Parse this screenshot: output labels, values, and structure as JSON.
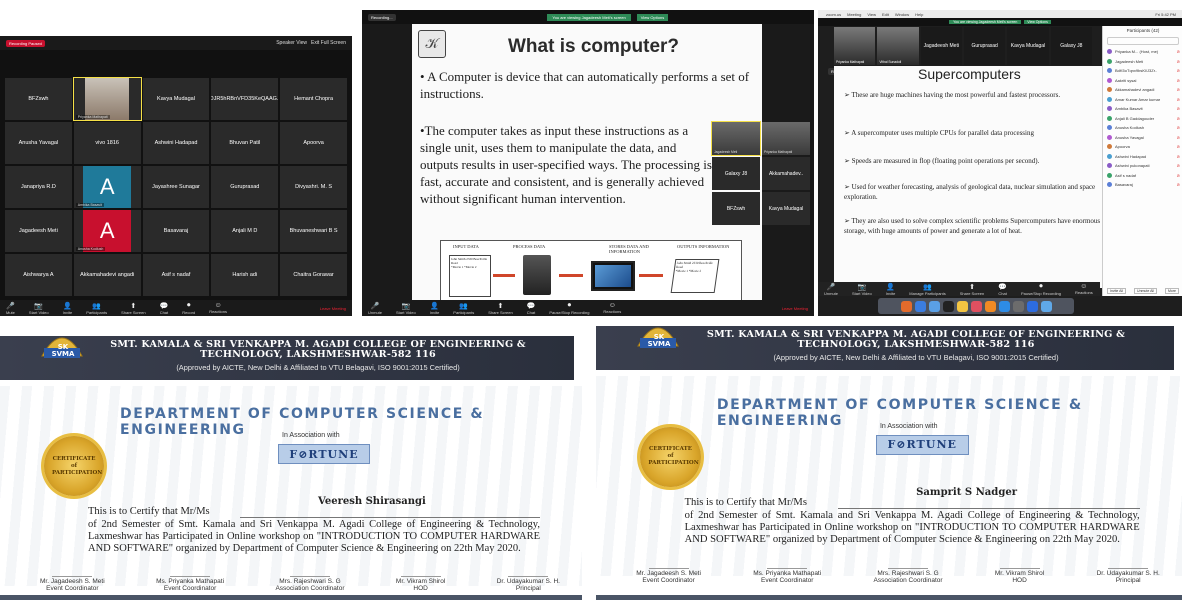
{
  "zoom_gallery": {
    "recording_label": "Recording Paused",
    "top_right": "Speaker View",
    "top_right2": "Exit Full Screen",
    "tiles": [
      {
        "name": "BFZswh"
      },
      {
        "name": "Priyanka Mathapati",
        "photo": true,
        "active": true
      },
      {
        "name": "Kavya Mudagal"
      },
      {
        "name": "DJR5hRBnVFD35KeQAAG.."
      },
      {
        "name": "Hemant Chopra"
      },
      {
        "name": "Anusha Yavagal"
      },
      {
        "name": "vivo 1816"
      },
      {
        "name": "Ashwini Hadapad"
      },
      {
        "name": "Bhuvan Patil"
      },
      {
        "name": "Apoorva"
      },
      {
        "name": "Janapriya R.D"
      },
      {
        "name": "A",
        "avatar": true,
        "color": "#1f7a9a",
        "sub": "Ambika Basavit"
      },
      {
        "name": "Jayashree Sunagar"
      },
      {
        "name": "Guruprasad"
      },
      {
        "name": "Divyashri. M. S"
      },
      {
        "name": "Jagadeesh Meti"
      },
      {
        "name": "A",
        "avatar": true,
        "color": "#c8102e",
        "sub": "Anusha Kodlush"
      },
      {
        "name": "Basavaraj"
      },
      {
        "name": "Anjali M D"
      },
      {
        "name": "Bhuvaneshwari B S"
      },
      {
        "name": "Aishwarya A"
      },
      {
        "name": "Akkamahadevi angadi"
      },
      {
        "name": "Asif s nadaf"
      },
      {
        "name": "Harish adi"
      },
      {
        "name": "Chaitra Gorawar"
      }
    ],
    "toolbar": [
      "Mute",
      "Start Video",
      "Invite",
      "Participants",
      "Share Screen",
      "Chat",
      "Record",
      "Reactions"
    ],
    "leave": "Leave Meeting"
  },
  "zoom_slide": {
    "banner": "You are viewing Jagadeesh Meti's screen",
    "view_options": "View Options",
    "recording_label": "Recording...",
    "title": "What is computer?",
    "bullet1": "• A Computer is device that can automatically performs a set of instructions.",
    "bullet2": "•The computer takes  as input these instructions as a single unit, uses  them to manipulate the data, and outputs results in user-specified ways. The processing is fast, accurate and consistent, and is generally  achieved without significant human intervention.",
    "flow": {
      "input": "INPUT DATA",
      "process": "PROCESS DATA",
      "stores": "STORES DATA AND INFORMATION",
      "outputs": "OUTPUTS INFORMATION",
      "card": "John Smith 2330 Beechville Road",
      "movies": "*Movie 1 *Movie 2"
    },
    "tiles": [
      {
        "name": "Jagadeesh Meti",
        "photo": true,
        "active": true
      },
      {
        "name": "Priyanka Mathapati",
        "photo": true
      },
      {
        "name": "Galaxy J8"
      },
      {
        "name": "Akkamahadev.."
      },
      {
        "name": "BFZswh"
      },
      {
        "name": "Kavya Mudagal"
      }
    ],
    "toolbar": [
      "Unmute",
      "Start Video",
      "Invite",
      "Participants",
      "Share Screen",
      "Chat",
      "Pause/Stop Recording",
      "Reactions"
    ],
    "leave": "Leave Meeting"
  },
  "zoom_super": {
    "menubar": [
      "zoom.us",
      "Meeting",
      "View",
      "Edit",
      "Window",
      "Help"
    ],
    "banner": "You are viewing Jagadeesh Meti's screen",
    "view_options": "View Options",
    "clock": "Fri 5:42 PM",
    "thumbs": [
      {
        "name": "Priyanka Mathapati",
        "photo": true
      },
      {
        "name": "Vithal Sunadoli",
        "photo": true
      },
      {
        "name": "Jagadeesh Meti"
      },
      {
        "name": "Guruprasad"
      },
      {
        "name": "Kavya Mudagal"
      },
      {
        "name": "Galaxy J8"
      }
    ],
    "recording_label": "Recording...",
    "title": "Supercomputers",
    "bullets": [
      "➢ These are huge machines having the most powerful and fastest processors.",
      "➢ A supercomputer uses multiple CPUs for parallel data processing",
      "➢ Speeds are measured in flop (floating point operations per second).",
      "➢ Used for weather forecasting, analysis of geological data, nuclear simulation and space exploration.",
      "➢ They are also used to solve complex scientific problems Supercomputers have enormous storage, with huge amounts of power and generate a lot of heat."
    ],
    "participants_title": "Participants (42)",
    "participants": [
      "Priyanka M... (Host, me)",
      "Jagadeesh Meti",
      "BdK5oTqnx9bsKl/J3Zr..",
      "Aakriti sysal",
      "Akkamahadevi angadi",
      "Amar Kumar Amar kumar",
      "Ambika Basavit",
      "Anjali B Gaddagouder",
      "Anusha Kodlush",
      "Anusha Yavagal",
      "Apoorva",
      "Ashwini Hadapad",
      "Ashwini pukonapati",
      "Asif s nadaf",
      "Basavaraj"
    ],
    "footer": [
      "Invite All",
      "Unmute All",
      "More"
    ],
    "toolbar": [
      "Unmute",
      "Start Video",
      "Invite",
      "Manage Participants",
      "Share Screen",
      "Chat",
      "Pause/Stop Recording",
      "Reactions"
    ]
  },
  "certificates": [
    {
      "college": "SMT. KAMALA & SRI VENKAPPA M. AGADI COLLEGE OF ENGINEERING & TECHNOLOGY, LAKSHMESHWAR-582 116",
      "approved": "(Approved by AICTE, New Delhi & Affiliated to VTU Belagavi, ISO 9001:2015 Certified)",
      "badge": "SK SVMA",
      "department": "DEPARTMENT OF  COMPUTER SCIENCE & ENGINEERING",
      "association": "In Association with",
      "partner": "F⊘RTUNE",
      "seal": "CERTIFICATE of PARTICIPATION",
      "recipient": "Veeresh Shirasangi",
      "certify": "This is to Certify that Mr/Ms",
      "body": "of 2nd Semester of Smt. Kamala and Sri Venkappa M. Agadi College of Engineering & Technology, Laxmeshwar has Participated in Online workshop on \"INTRODUCTION TO COMPUTER HARDWARE AND SOFTWARE\" organized by Department of Computer Science & Engineering on 22th May 2020.",
      "signatories": [
        {
          "name": "Mr. Jagadeesh S. Meti",
          "role": "Event Coordinator"
        },
        {
          "name": "Ms. Priyanka Mathapati",
          "role": "Event Coordinator"
        },
        {
          "name": "Mrs. Rajeshwari S. G",
          "role": "Association  Coordinator"
        },
        {
          "name": "Mr. Vikram Shirol",
          "role": "HOD"
        },
        {
          "name": "Dr. Udayakumar S. H.",
          "role": "Principal"
        }
      ]
    },
    {
      "college": "SMT. KAMALA & SRI VENKAPPA M. AGADI COLLEGE OF ENGINEERING & TECHNOLOGY, LAKSHMESHWAR-582 116",
      "approved": "(Approved by AICTE, New Delhi & Affiliated to VTU Belagavi, ISO 9001:2015 Certified)",
      "badge": "SK SVMA",
      "department": "DEPARTMENT OF  COMPUTER SCIENCE & ENGINEERING",
      "association": "In Association with",
      "partner": "F⊘RTUNE",
      "seal": "CERTIFICATE of PARTICIPATION",
      "recipient": "Samprit S Nadger",
      "certify": "This is to Certify that Mr/Ms",
      "body": "of 2nd Semester of Smt. Kamala and Sri Venkappa M. Agadi College of Engineering & Technology, Laxmeshwar has Participated in Online workshop on \"INTRODUCTION TO COMPUTER HARDWARE AND SOFTWARE\" organized by Department of Computer Science & Engineering on 22th May 2020.",
      "signatories": [
        {
          "name": "Mr. Jagadeesh S. Meti",
          "role": "Event Coordinator"
        },
        {
          "name": "Ms. Priyanka Mathapati",
          "role": "Event Coordinator"
        },
        {
          "name": "Mrs. Rajeshwari S. G",
          "role": "Association  Coordinator"
        },
        {
          "name": "Mr. Vikram Shirol",
          "role": "HOD"
        },
        {
          "name": "Dr. Udayakumar S. H.",
          "role": "Principal"
        }
      ]
    }
  ]
}
